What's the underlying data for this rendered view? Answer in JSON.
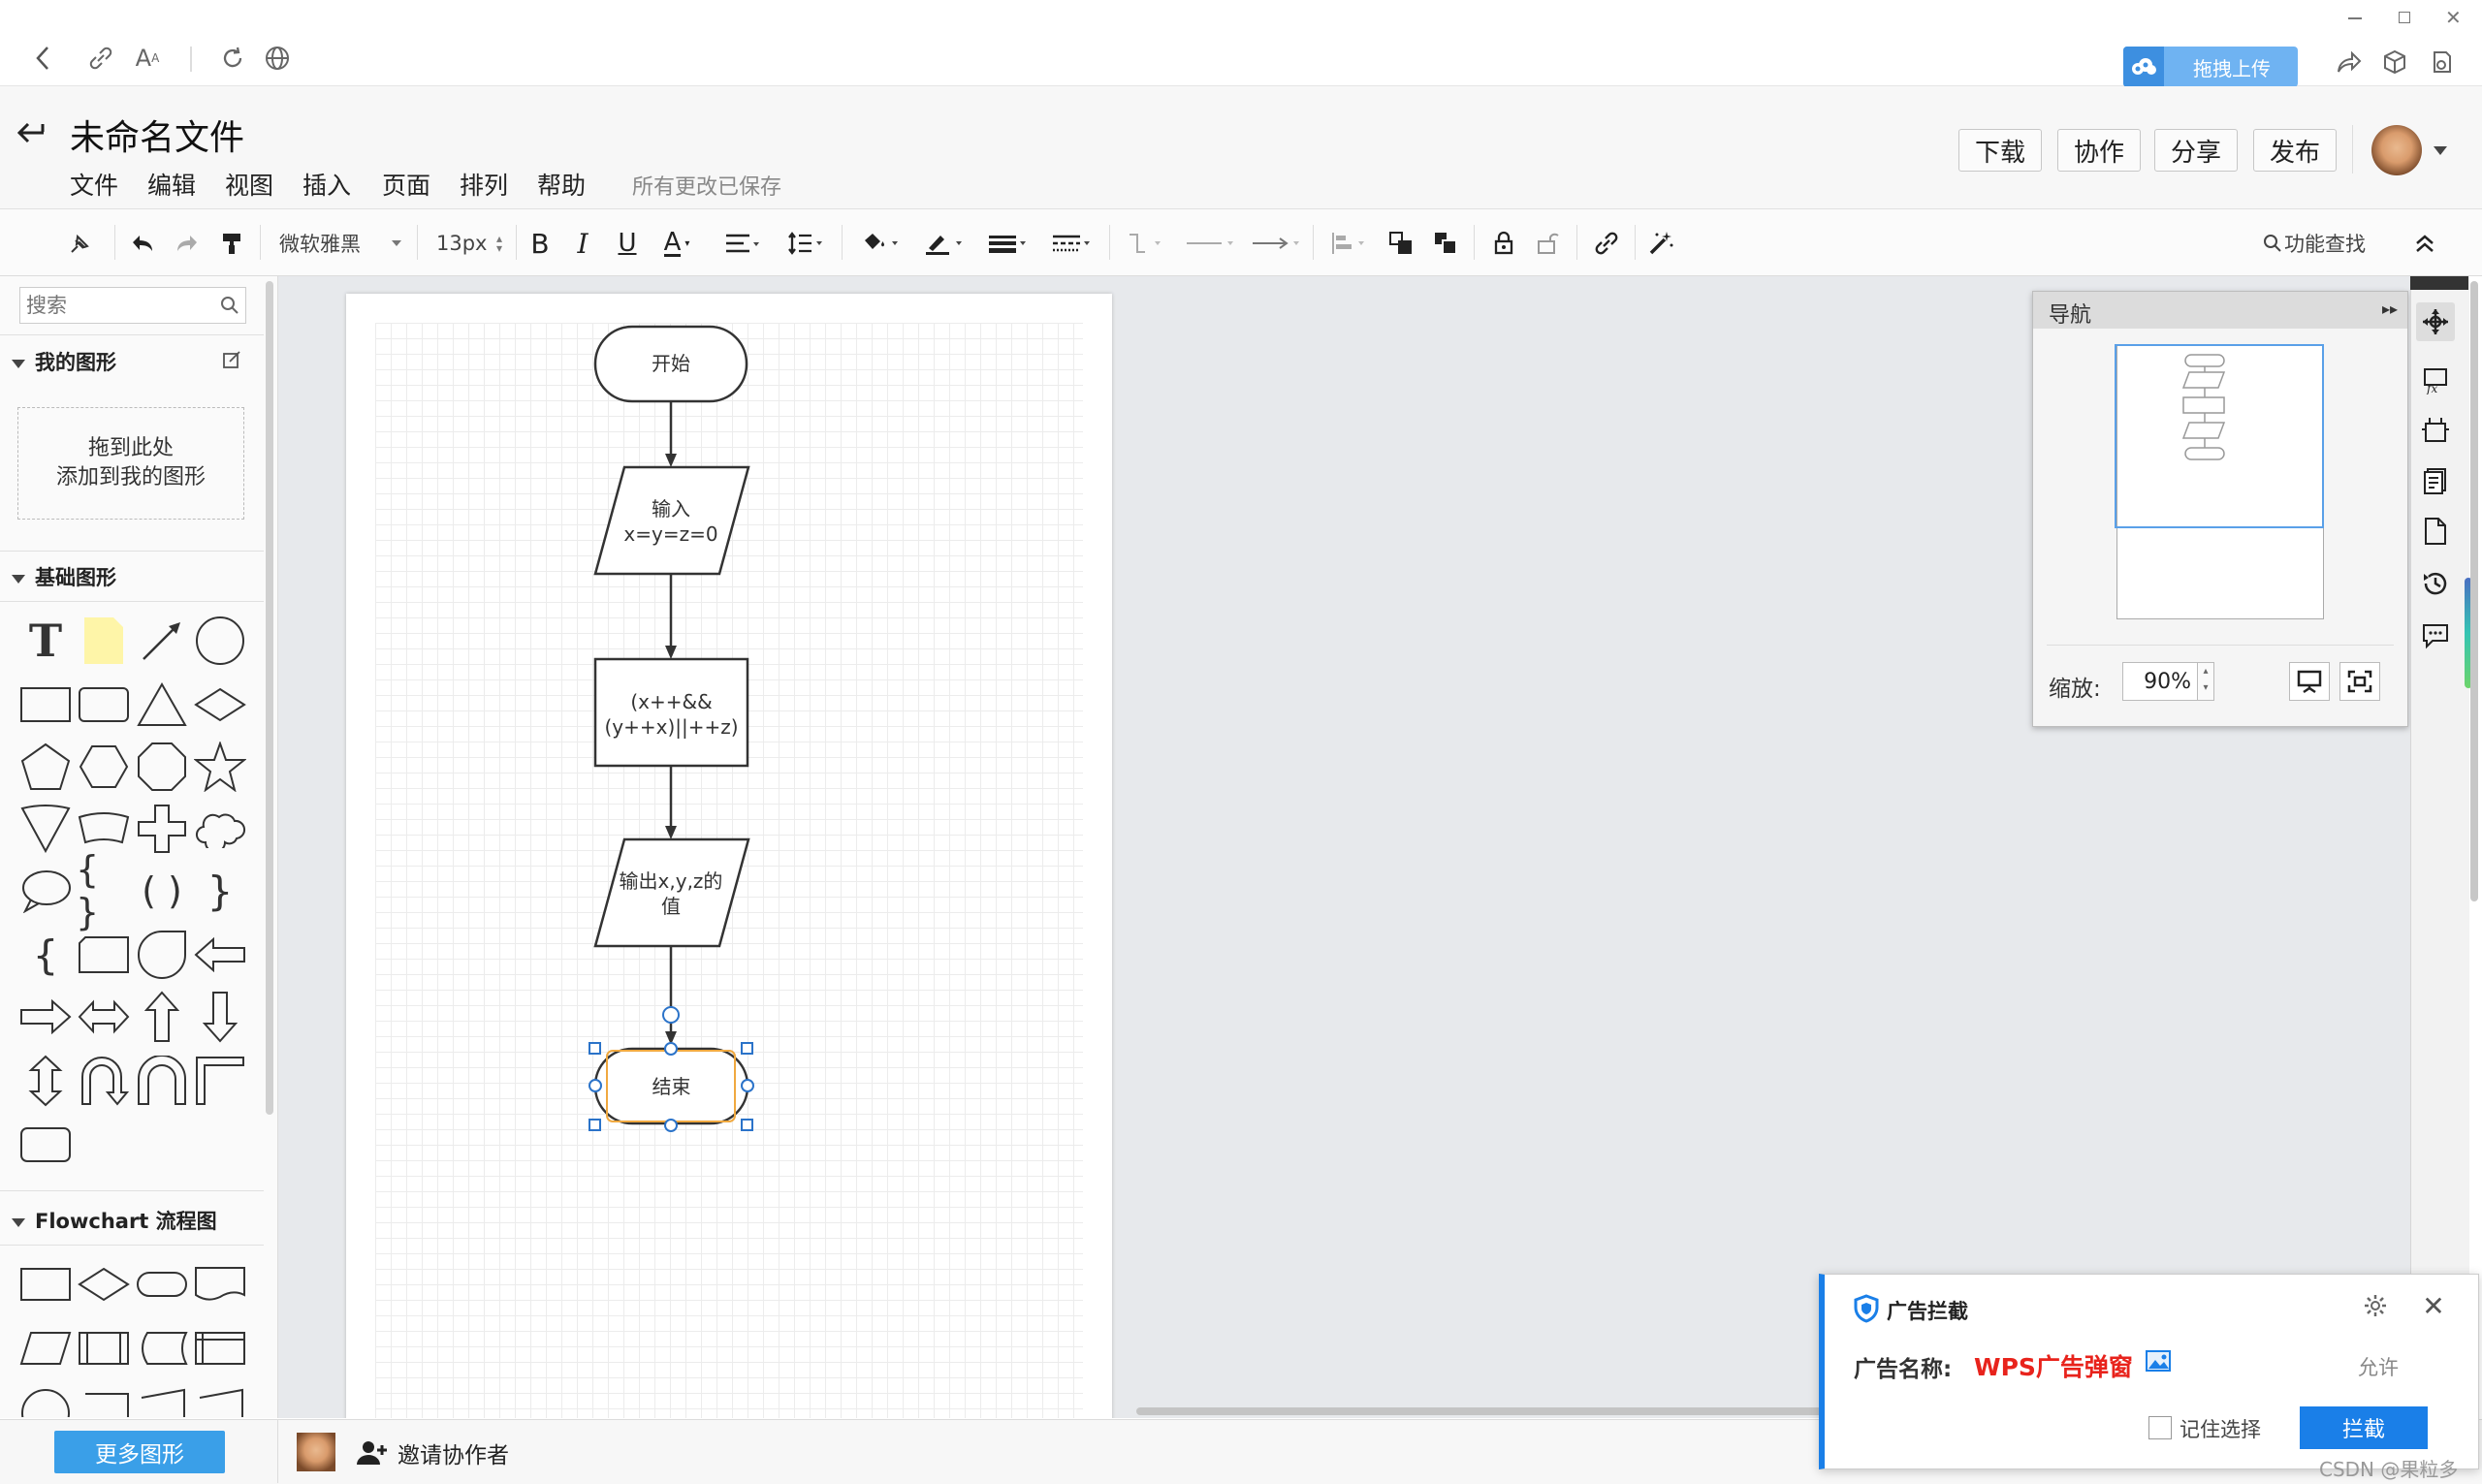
{
  "browser": {
    "upload_label": "拖拽上传"
  },
  "doc": {
    "title": "未命名文件",
    "save_status": "所有更改已保存"
  },
  "menu": [
    "文件",
    "编辑",
    "视图",
    "插入",
    "页面",
    "排列",
    "帮助"
  ],
  "header_buttons": {
    "download": "下载",
    "collaborate": "协作",
    "share": "分享",
    "publish": "发布"
  },
  "toolbar": {
    "font_family": "微软雅黑",
    "font_size": "13px",
    "feature_search": "功能查找"
  },
  "sidebar": {
    "search_placeholder": "搜索",
    "my_shapes_title": "我的图形",
    "drop_hint_line1": "拖到此处",
    "drop_hint_line2": "添加到我的图形",
    "basic_shapes_title": "基础图形",
    "flowchart_title": "Flowchart 流程图",
    "more_shapes": "更多图形"
  },
  "flowchart": {
    "start": "开始",
    "input_line1": "输入",
    "input_line2": "x=y=z=0",
    "cond_line1": "(x++&&",
    "cond_line2": "(y++x)||++z)",
    "output_line1": "输出x,y,z的",
    "output_line2": "值",
    "end": "结束"
  },
  "navigator": {
    "title": "导航",
    "zoom_label": "缩放:",
    "zoom_value": "90%"
  },
  "bottom": {
    "invite": "邀请协作者"
  },
  "ad_blocker": {
    "title": "广告拦截",
    "name_label": "广告名称:",
    "name_value": "WPS广告弹窗",
    "allow": "允许",
    "remember": "记住选择",
    "block": "拦截"
  },
  "watermark": "CSDN @果粒多",
  "colors": {
    "accent_blue": "#1a7fe8",
    "ad_red": "#e8231c",
    "selection_blue": "#2b73c9",
    "selection_orange": "#f0a940",
    "canvas_bg": "#e6e8ec",
    "more_shapes_btn": "#3a9fe8"
  }
}
